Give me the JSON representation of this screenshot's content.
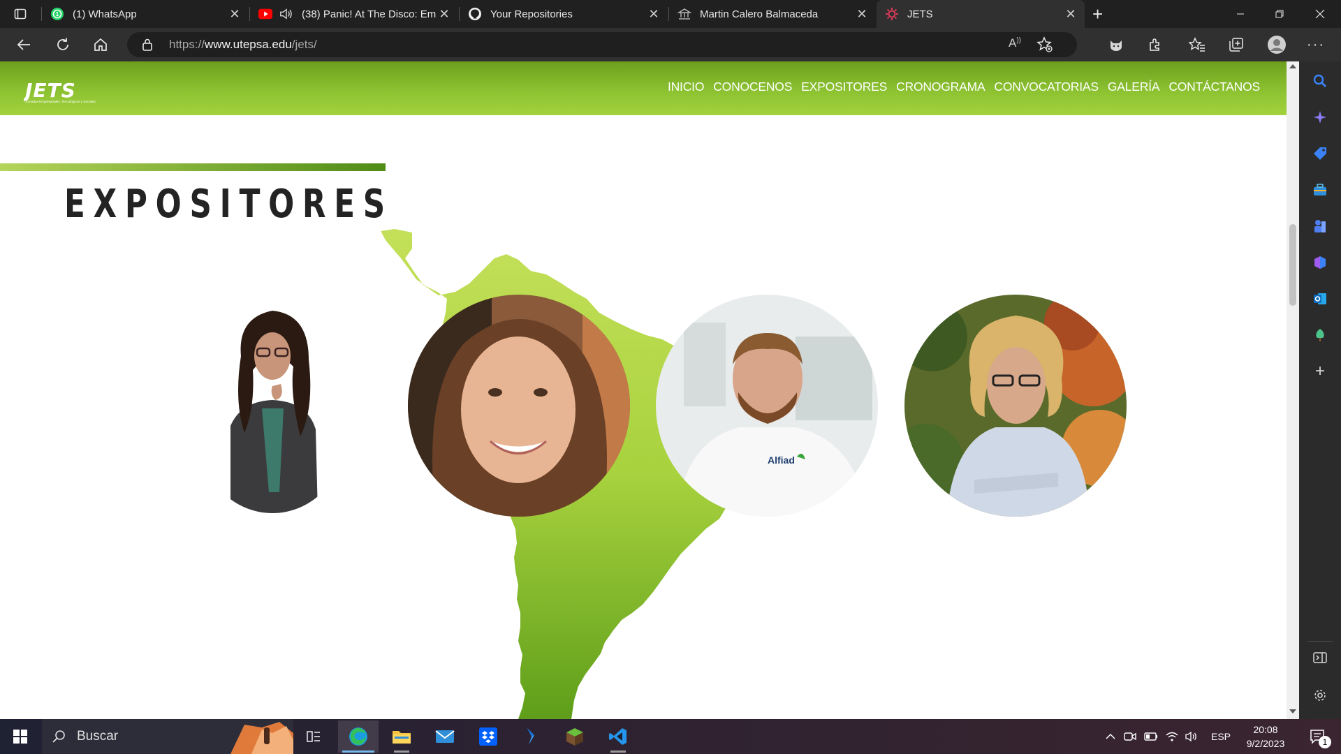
{
  "browser": {
    "tabs": [
      {
        "title": "(1) WhatsApp",
        "icon": "whatsapp-icon",
        "active": false
      },
      {
        "title": "(38) Panic! At The Disco: Em",
        "icon": "youtube-icon",
        "active": false
      },
      {
        "title": "Your Repositories",
        "icon": "github-icon",
        "active": false
      },
      {
        "title": "Martin Calero Balmaceda",
        "icon": "university-icon",
        "active": false
      },
      {
        "title": "JETS",
        "icon": "jets-icon",
        "active": true
      }
    ],
    "url": {
      "scheme": "https://",
      "host": "www.utepsa.edu",
      "path": "/jets/"
    }
  },
  "site": {
    "logo_text": "JETS",
    "logo_tagline": "Jornadas Empresariales, Tecnológicas y Sociales",
    "brand_colors": {
      "green_dark": "#6d9f1d",
      "green_light": "#a3d23e",
      "map_green": "#a6cf3a"
    },
    "nav": [
      "INICIO",
      "CONOCENOS",
      "EXPOSITORES",
      "CRONOGRAMA",
      "CONVOCATORIAS",
      "GALERÍA",
      "CONTÁCTANOS"
    ],
    "section_title": "EXPOSITORES",
    "speakers": [
      {
        "name": "speaker-1",
        "style": "cutout"
      },
      {
        "name": "speaker-2",
        "style": "circle"
      },
      {
        "name": "speaker-3",
        "style": "circle",
        "shirt_logo": "Alfiad"
      },
      {
        "name": "speaker-4",
        "style": "circle"
      }
    ]
  },
  "taskbar": {
    "search_placeholder": "Buscar",
    "language": "ESP",
    "time": "20:08",
    "date": "9/2/2023",
    "notification_count": "1"
  }
}
